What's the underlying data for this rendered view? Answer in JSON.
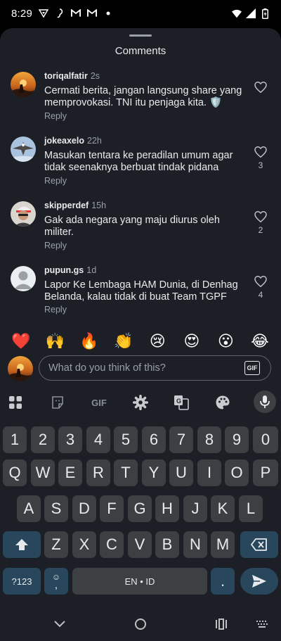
{
  "status_bar": {
    "time": "8:29",
    "notification_icons": [
      "vpn-icon",
      "ear-icon",
      "gmail-icon",
      "gmail-icon",
      "dot-icon"
    ],
    "system_icons": [
      "wifi-icon",
      "signal-icon",
      "battery-icon"
    ]
  },
  "sheet": {
    "title": "Comments"
  },
  "comments": [
    {
      "username": "toriqalfatir",
      "time": "2s",
      "text": "Cermati berita, jangan langsung share yang memprovokasi. TNI itu penjaga kita. 🛡️",
      "reply_label": "Reply",
      "likes": ""
    },
    {
      "username": "jokeaxelo",
      "time": "22h",
      "text": "Masukan tentara ke peradilan umum agar tidak seenaknya berbuat tindak pidana",
      "reply_label": "Reply",
      "likes": "3"
    },
    {
      "username": "skipperdef",
      "time": "15h",
      "text": "Gak ada negara yang maju diurus oleh militer.",
      "reply_label": "Reply",
      "likes": "2"
    },
    {
      "username": "pupun.gs",
      "time": "1d",
      "text": "Lapor Ke Lembaga HAM Dunia, di Denhag Belanda, kalau tidak di buat Team TGPF",
      "reply_label": "Reply",
      "likes": "4"
    }
  ],
  "emoji_bar": [
    "❤️",
    "🙌",
    "🔥",
    "👏",
    "😢",
    "😍",
    "😮",
    "😂"
  ],
  "composer": {
    "placeholder": "What do you think of this?",
    "gif_label": "GIF"
  },
  "keyboard": {
    "toolbar": {
      "gif_label": "GIF",
      "icons": [
        "apps-grid-icon",
        "sticker-icon",
        "gif-icon",
        "settings-icon",
        "translate-icon",
        "palette-icon",
        "mic-icon"
      ]
    },
    "row_numbers": [
      "1",
      "2",
      "3",
      "4",
      "5",
      "6",
      "7",
      "8",
      "9",
      "0"
    ],
    "row_top": [
      "Q",
      "W",
      "E",
      "R",
      "T",
      "Y",
      "U",
      "I",
      "O",
      "P"
    ],
    "row_middle": [
      "A",
      "S",
      "D",
      "F",
      "G",
      "H",
      "J",
      "K",
      "L"
    ],
    "row_bottom": [
      "Z",
      "X",
      "C",
      "V",
      "B",
      "N",
      "M"
    ],
    "symbols_label": "?123",
    "space_label": "EN • ID",
    "period_label": ".",
    "comma_label": ","
  },
  "colors": {
    "sheet_bg": "#1c2026",
    "key_bg": "#3c4043",
    "accent_key_bg": "#28475d"
  }
}
